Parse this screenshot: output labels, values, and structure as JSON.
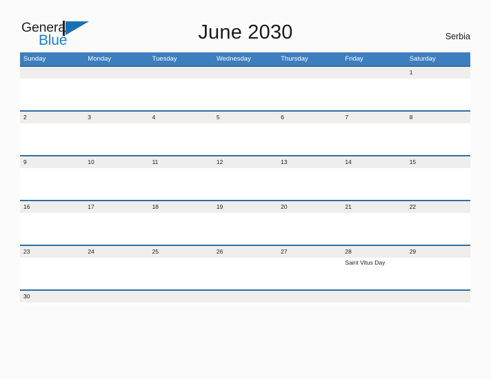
{
  "brand": {
    "name_part1": "General",
    "name_part2": "Blue",
    "mark_icon": "blue-triangle-flag-icon",
    "color_dark": "#231f20",
    "color_blue": "#1a7fd4"
  },
  "header": {
    "title": "June 2030",
    "country": "Serbia"
  },
  "theme": {
    "header_blue": "#3d7ebe",
    "separator_blue": "#2e6da4",
    "day_band_gray": "#efeeec",
    "page_background": "#fbfbfb",
    "text_color": "#1b1b1b"
  },
  "calendar": {
    "month": "June",
    "year": "2030",
    "weekday_headers": [
      "Sunday",
      "Monday",
      "Tuesday",
      "Wednesday",
      "Thursday",
      "Friday",
      "Saturday"
    ],
    "weeks": [
      {
        "days": [
          {
            "number": "",
            "events": []
          },
          {
            "number": "",
            "events": []
          },
          {
            "number": "",
            "events": []
          },
          {
            "number": "",
            "events": []
          },
          {
            "number": "",
            "events": []
          },
          {
            "number": "",
            "events": []
          },
          {
            "number": "1",
            "events": []
          }
        ]
      },
      {
        "days": [
          {
            "number": "2",
            "events": []
          },
          {
            "number": "3",
            "events": []
          },
          {
            "number": "4",
            "events": []
          },
          {
            "number": "5",
            "events": []
          },
          {
            "number": "6",
            "events": []
          },
          {
            "number": "7",
            "events": []
          },
          {
            "number": "8",
            "events": []
          }
        ]
      },
      {
        "days": [
          {
            "number": "9",
            "events": []
          },
          {
            "number": "10",
            "events": []
          },
          {
            "number": "11",
            "events": []
          },
          {
            "number": "12",
            "events": []
          },
          {
            "number": "13",
            "events": []
          },
          {
            "number": "14",
            "events": []
          },
          {
            "number": "15",
            "events": []
          }
        ]
      },
      {
        "days": [
          {
            "number": "16",
            "events": []
          },
          {
            "number": "17",
            "events": []
          },
          {
            "number": "18",
            "events": []
          },
          {
            "number": "19",
            "events": []
          },
          {
            "number": "20",
            "events": []
          },
          {
            "number": "21",
            "events": []
          },
          {
            "number": "22",
            "events": []
          }
        ]
      },
      {
        "days": [
          {
            "number": "23",
            "events": []
          },
          {
            "number": "24",
            "events": []
          },
          {
            "number": "25",
            "events": []
          },
          {
            "number": "26",
            "events": []
          },
          {
            "number": "27",
            "events": []
          },
          {
            "number": "28",
            "events": [
              "Saint Vitus Day"
            ]
          },
          {
            "number": "29",
            "events": []
          }
        ]
      },
      {
        "days": [
          {
            "number": "30",
            "events": []
          },
          {
            "number": "",
            "events": []
          },
          {
            "number": "",
            "events": []
          },
          {
            "number": "",
            "events": []
          },
          {
            "number": "",
            "events": []
          },
          {
            "number": "",
            "events": []
          },
          {
            "number": "",
            "events": []
          }
        ]
      }
    ]
  }
}
